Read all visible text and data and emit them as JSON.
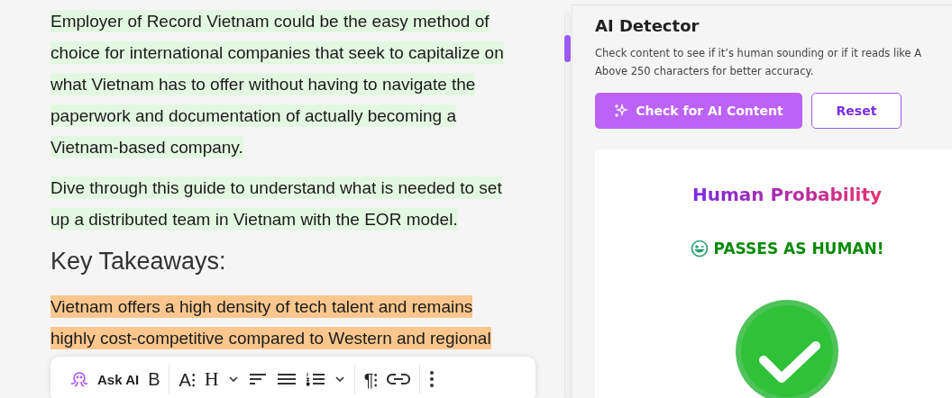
{
  "editor": {
    "paragraphs": [
      {
        "kind": "text",
        "color": "#e3f8e0",
        "lines": [
          "Employer of Record Vietnam could be the easy method of",
          "choice for international companies that seek to capitalize on",
          "what Vietnam has to offer without having to navigate the",
          "paperwork and documentation of actually becoming a",
          "Vietnam-based company."
        ]
      },
      {
        "kind": "text",
        "color": "#e3f8e0",
        "lines": [
          "Dive through this guide to understand what is needed to set",
          "up a distributed team in Vietnam with the EOR model."
        ]
      },
      {
        "kind": "heading",
        "lines": [
          "Key Takeaways:"
        ]
      },
      {
        "kind": "text",
        "color": "#fbc78e",
        "lines": [
          "Vietnam offers a high density of tech talent and remains",
          "highly cost-competitive compared to Western and regional"
        ]
      }
    ]
  },
  "toolbar": {
    "ask_ai": "Ask AI",
    "bold": "B",
    "font_size": "A⁝",
    "heading": "H",
    "paragraph": "¶⁝"
  },
  "detector": {
    "title": "AI Detector",
    "description": [
      "Check content to see if it’s human sounding or if it reads like A",
      "Above 250 characters for better accuracy."
    ],
    "check_button": "Check for AI Content",
    "reset_button": "Reset",
    "result_title": "Human Probability",
    "verdict": "PASSES AS HUMAN!",
    "passed": true
  }
}
